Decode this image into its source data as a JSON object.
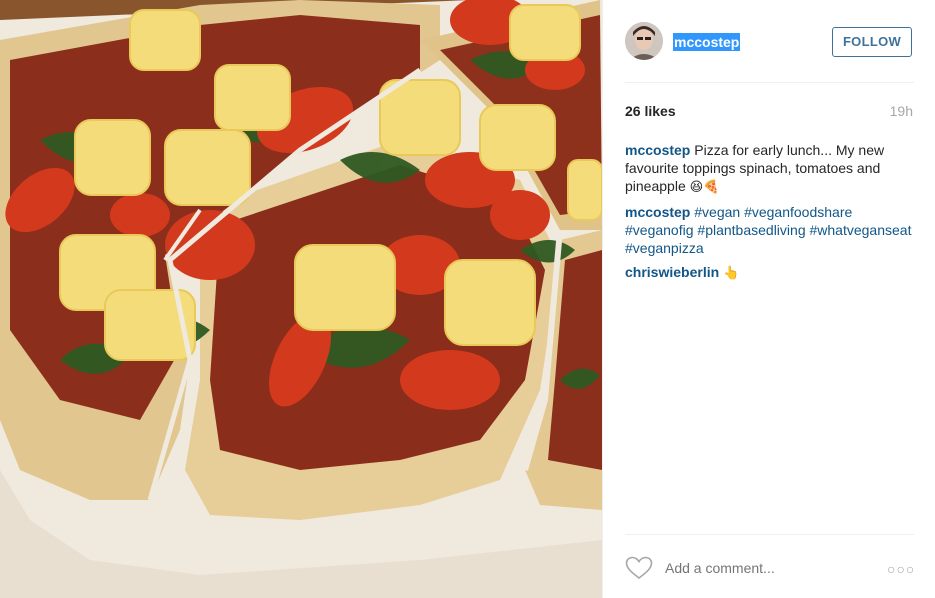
{
  "post": {
    "image_alt": "pizza with spinach, tomatoes and pineapple",
    "user": {
      "username": "mccostep",
      "follow_label": "FOLLOW"
    },
    "likes": "26 likes",
    "time": "19h",
    "comments": [
      {
        "user": "mccostep",
        "text": "Pizza for early lunch... My new favourite toppings spinach, tomatoes and pineapple",
        "emoji": "😆🍕"
      },
      {
        "user": "mccostep",
        "tags": [
          "#vegan",
          "#veganfoodshare",
          "#veganofig",
          "#plantbasedliving",
          "#whatveganseat",
          "#veganpizza"
        ]
      },
      {
        "user": "chriswieberlin",
        "emoji": "👆"
      }
    ],
    "comment_placeholder": "Add a comment...",
    "more_label": "○○○"
  },
  "colors": {
    "link": "#125688",
    "follow": "#3f729b",
    "muted": "#a5a7aa",
    "selection": "#3297fd"
  },
  "icons": [
    "heart-icon",
    "more-options-icon"
  ]
}
